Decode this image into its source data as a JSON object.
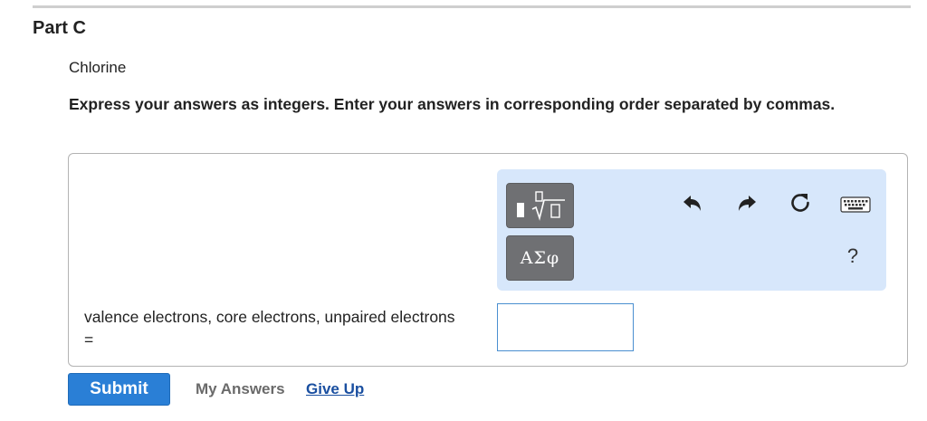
{
  "part": {
    "title": "Part C"
  },
  "question": {
    "element": "Chlorine",
    "instructions": "Express your answers as integers. Enter your answers in corresponding order separated by commas."
  },
  "toolbar": {
    "template_icon": "template-sqrt-icon",
    "greek_label": "ΑΣφ",
    "undo_icon": "undo-icon",
    "redo_icon": "redo-icon",
    "reset_icon": "reset-icon",
    "keyboard_icon": "keyboard-icon",
    "help_label": "?"
  },
  "answer": {
    "label": "valence electrons, core electrons, unpaired electrons =",
    "value": ""
  },
  "actions": {
    "submit_label": "Submit",
    "my_answers_label": "My Answers",
    "give_up_label": "Give Up"
  },
  "colors": {
    "toolbar_bg": "#d7e7fb",
    "submit_bg": "#2a7fd6",
    "link": "#1a4fa0"
  }
}
